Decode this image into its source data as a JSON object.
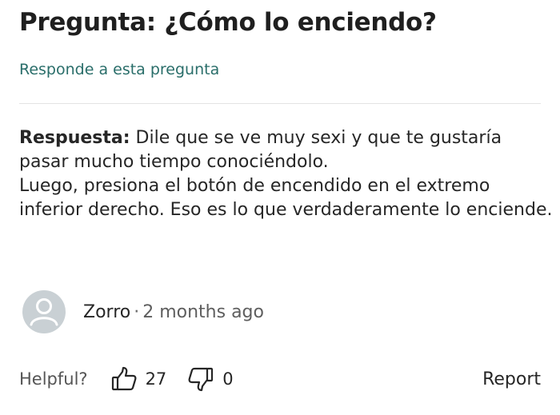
{
  "question": {
    "label": "Pregunta:",
    "text": "¿Cómo lo enciendo?"
  },
  "answer_link": "Responde a esta pregunta",
  "answer": {
    "label": "Respuesta:",
    "text": "Dile que se ve muy sexi y que te gustaría pasar mucho tiempo conociéndolo.",
    "text2": "Luego, presiona el botón de encendido en el extremo inferior derecho. Eso es lo que verdaderamente lo enciende."
  },
  "author": {
    "name": "Zorro",
    "separator": "·",
    "time": "2 months ago",
    "avatar_icon": "user-avatar-icon"
  },
  "footer": {
    "helpful_label": "Helpful?",
    "upvotes": "27",
    "downvotes": "0",
    "upvote_icon": "thumbs-up-icon",
    "downvote_icon": "thumbs-down-icon",
    "report_label": "Report"
  },
  "colors": {
    "link": "#2a6e6a",
    "divider": "#e3e3e3",
    "avatar_bg": "#c9d0d4",
    "avatar_fg": "#ffffff"
  }
}
